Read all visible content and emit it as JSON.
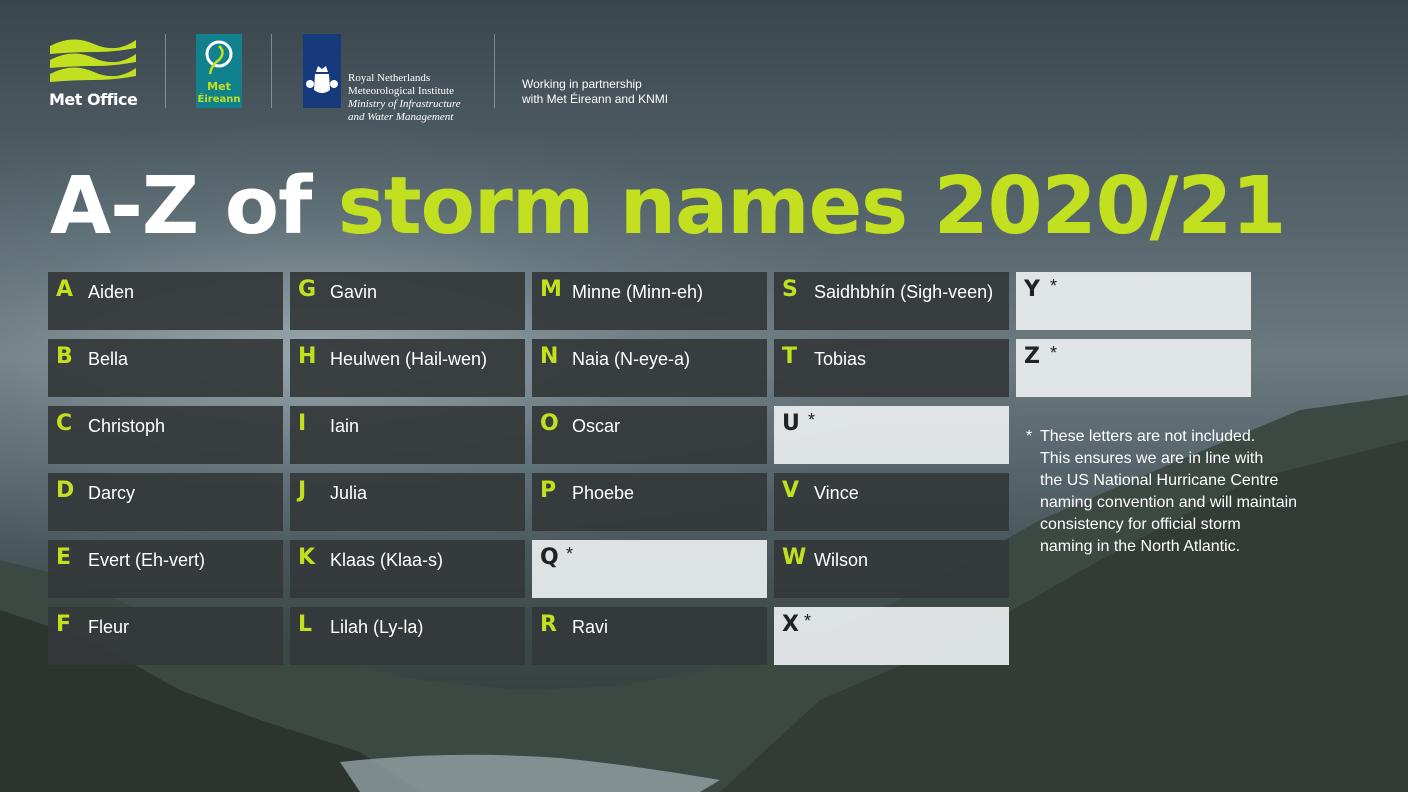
{
  "header": {
    "metoffice_label": "Met Office",
    "meteireann_label_1": "Met",
    "meteireann_label_2": "Éireann",
    "knmi_lines": [
      "Royal Netherlands",
      "Meteorological Institute",
      "Ministry of Infrastructure",
      "and Water Management"
    ],
    "partner_lines": [
      "Working in partnership",
      "with Met Éireann and KNMI"
    ]
  },
  "title": {
    "part_white": "A-Z of ",
    "part_green": "storm names 2020/21"
  },
  "colors": {
    "accent": "#c2e01f",
    "cell_dark": "#34383a",
    "cell_light": "#e6eaec"
  },
  "columns": [
    [
      {
        "letter": "A",
        "name": "Aiden"
      },
      {
        "letter": "B",
        "name": "Bella"
      },
      {
        "letter": "C",
        "name": "Christoph"
      },
      {
        "letter": "D",
        "name": "Darcy"
      },
      {
        "letter": "E",
        "name": "Evert (Eh-vert)"
      },
      {
        "letter": "F",
        "name": "Fleur"
      }
    ],
    [
      {
        "letter": "G",
        "name": "Gavin"
      },
      {
        "letter": "H",
        "name": "Heulwen (Hail-wen)"
      },
      {
        "letter": "I",
        "name": "Iain"
      },
      {
        "letter": "J",
        "name": "Julia"
      },
      {
        "letter": "K",
        "name": "Klaas (Klaa-s)"
      },
      {
        "letter": "L",
        "name": "Lilah (Ly-la)"
      }
    ],
    [
      {
        "letter": "M",
        "name": "Minne (Minn-eh)"
      },
      {
        "letter": "N",
        "name": "Naia (N-eye-a)"
      },
      {
        "letter": "O",
        "name": "Oscar"
      },
      {
        "letter": "P",
        "name": "Phoebe"
      },
      {
        "letter": "Q",
        "name": "",
        "excluded": true,
        "mark": "*"
      },
      {
        "letter": "R",
        "name": "Ravi"
      }
    ],
    [
      {
        "letter": "S",
        "name": "Saidhbhín (Sigh-veen)"
      },
      {
        "letter": "T",
        "name": "Tobias"
      },
      {
        "letter": "U",
        "name": "",
        "excluded": true,
        "mark": "*"
      },
      {
        "letter": "V",
        "name": "Vince"
      },
      {
        "letter": "W",
        "name": "Wilson"
      },
      {
        "letter": "X",
        "name": "",
        "excluded": true,
        "mark": "*"
      }
    ],
    [
      {
        "letter": "Y",
        "name": "",
        "excluded": true,
        "mark": "*"
      },
      {
        "letter": "Z",
        "name": "",
        "excluded": true,
        "mark": "*"
      }
    ]
  ],
  "note": {
    "asterisk": "*",
    "lines": [
      "These letters are not included.",
      "This ensures we are in line with",
      "the US National Hurricane Centre",
      "naming convention and will maintain",
      "consistency for official storm",
      "naming in the North Atlantic."
    ]
  }
}
